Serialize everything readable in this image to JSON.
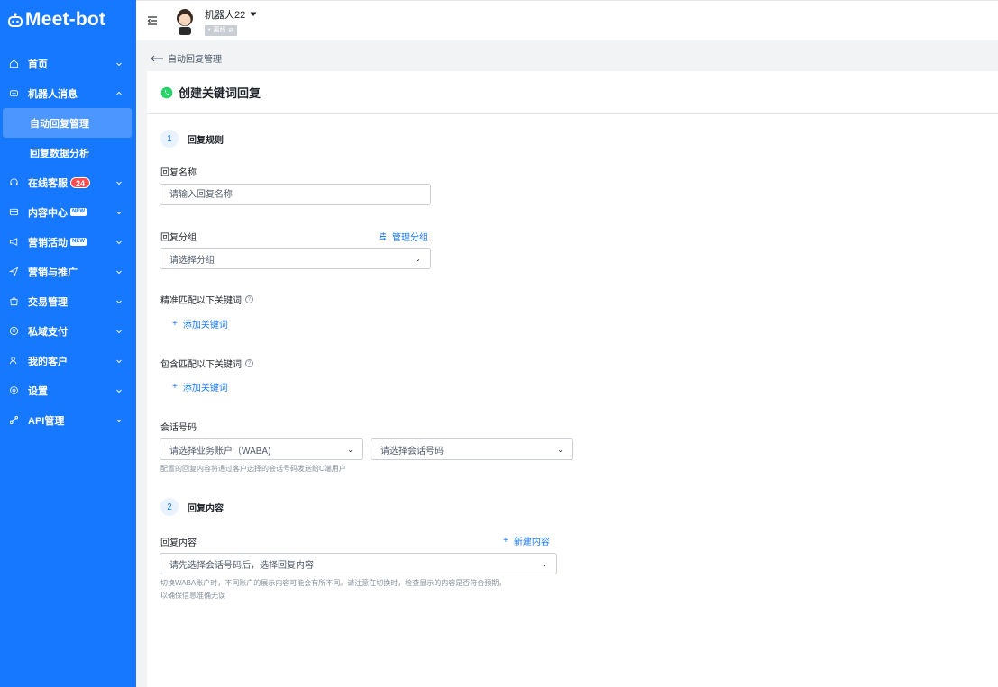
{
  "brand": {
    "name": "Meet-bot"
  },
  "sidebar": {
    "items": [
      {
        "label": "首页",
        "icon": "home-icon"
      },
      {
        "label": "机器人消息",
        "icon": "robot-icon"
      },
      {
        "label": "在线客服",
        "icon": "headset-icon",
        "badge": "24"
      },
      {
        "label": "内容中心",
        "icon": "content-icon",
        "new_badge": "NEW"
      },
      {
        "label": "营销活动",
        "icon": "megaphone-icon",
        "new_badge": "NEW"
      },
      {
        "label": "营销与推广",
        "icon": "send-icon"
      },
      {
        "label": "交易管理",
        "icon": "bag-icon"
      },
      {
        "label": "私域支付",
        "icon": "coin-icon"
      },
      {
        "label": "我的客户",
        "icon": "users-icon"
      },
      {
        "label": "设置",
        "icon": "gear-icon"
      },
      {
        "label": "API管理",
        "icon": "api-icon"
      }
    ],
    "sub_items": [
      {
        "label": "自动回复管理",
        "active": true
      },
      {
        "label": "回复数据分析",
        "active": false
      }
    ]
  },
  "topbar": {
    "bot_name": "机器人22",
    "status": "离线"
  },
  "breadcrumb": {
    "back_label": "自动回复管理"
  },
  "page": {
    "title": "创建关键词回复"
  },
  "step1": {
    "num": "1",
    "title": "回复规则"
  },
  "form": {
    "name_label": "回复名称",
    "name_placeholder": "请输入回复名称",
    "group_label": "回复分组",
    "group_manage": "管理分组",
    "group_placeholder": "请选择分组",
    "exact_label": "精准匹配以下关键词",
    "exact_add": "添加关键词",
    "contain_label": "包含匹配以下关键词",
    "contain_add": "添加关键词",
    "phone_label": "会话号码",
    "account_placeholder": "请选择业务账户（WABA)",
    "phone_placeholder": "请选择会话号码",
    "phone_hint": "配置的回复内容将通过客户选择的会话号码发送给C端用户"
  },
  "step2": {
    "num": "2",
    "title": "回复内容"
  },
  "content": {
    "label": "回复内容",
    "new_label": "新建内容",
    "placeholder": "请先选择会话号码后，选择回复内容",
    "hint_line1": "切换WABA账户时，不同账户的展示内容可能会有所不同。请注意在切换时，检查显示的内容是否符合预期，",
    "hint_line2": "以确保信息准确无误"
  },
  "colors": {
    "primary": "#1677ff",
    "badge": "#ff4d4f",
    "whatsapp": "#25d366"
  }
}
